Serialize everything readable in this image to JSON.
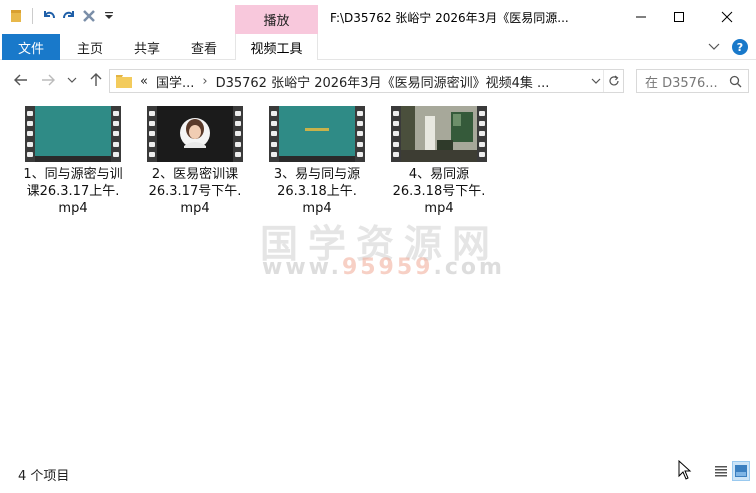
{
  "titlebar": {
    "play_tab": "播放",
    "window_title": "F:\\D35762 张峪宁 2026年3月《医易同源...",
    "controls": [
      "minimize-icon",
      "maximize-icon",
      "close-icon"
    ]
  },
  "ribbon": {
    "file": "文件",
    "tabs": [
      "主页",
      "共享",
      "查看"
    ],
    "video_tools": "视频工具",
    "help": "?"
  },
  "nav": {
    "breadcrumb_prefix": "«",
    "crumb1": "国学...",
    "crumb2": "D35762 张峪宁 2026年3月《医易同源密训》视频4集 ...",
    "search_placeholder": "在 D3576..."
  },
  "files": [
    {
      "name": "1、同与源密与训课26.3.17上午.mp4",
      "line1": "1、同与源密与训",
      "line2": "课26.3.17上午.",
      "line3": "mp4",
      "thumb": "teal-board"
    },
    {
      "name": "2、医易密训课26.3.17号下午.mp4",
      "line1": "2、医易密训课",
      "line2": "26.3.17号下午.",
      "line3": "mp4",
      "thumb": "portrait"
    },
    {
      "name": "3、易与同与源26.3.18上午.mp4",
      "line1": "3、易与同与源",
      "line2": "26.3.18上午.",
      "line3": "mp4",
      "thumb": "teal-board-text"
    },
    {
      "name": "4、易同源26.3.18号下午.mp4",
      "line1": "4、易同源",
      "line2": "26.3.18号下午.",
      "line3": "mp4",
      "thumb": "room"
    }
  ],
  "watermark": {
    "line1": "国学资源网",
    "line2_pre": "www.",
    "line2_hl": "95959",
    "line2_post": ".com"
  },
  "status": {
    "count": "4 个项目"
  },
  "colors": {
    "accent": "#1979ca",
    "play_tab": "#f8c8dc",
    "board": "#2f8b86"
  }
}
